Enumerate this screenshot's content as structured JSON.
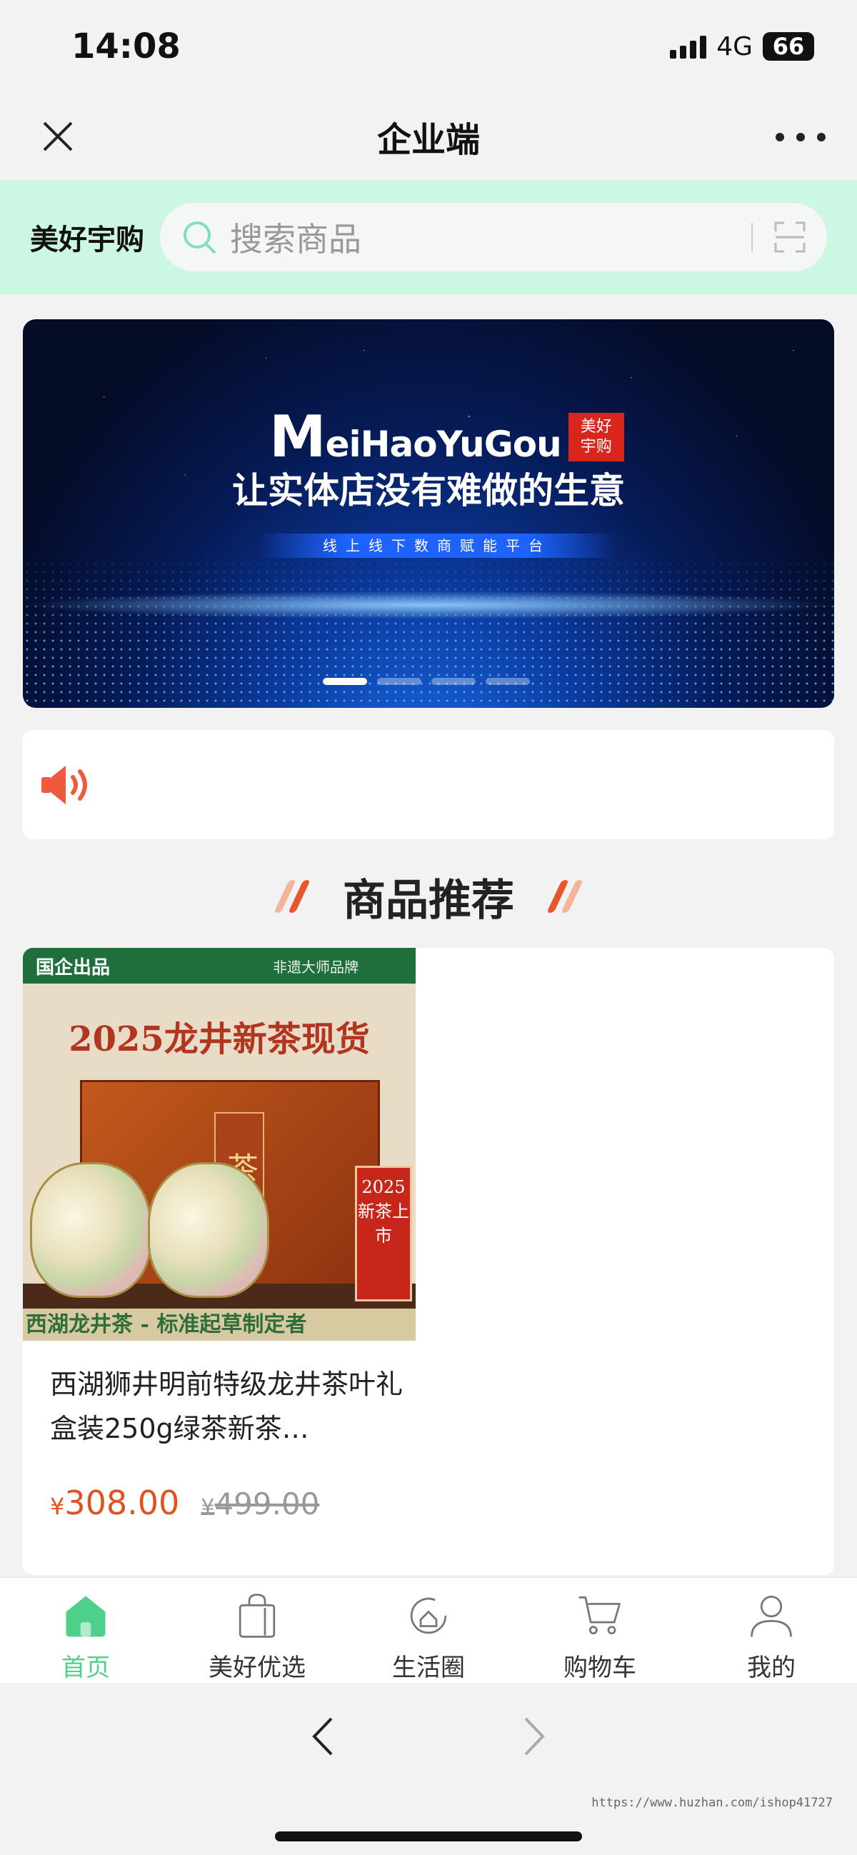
{
  "status_bar": {
    "time": "14:08",
    "network": "4G",
    "battery": "66"
  },
  "title_bar": {
    "title": "企业端"
  },
  "header": {
    "brand": "美好宇购",
    "search_placeholder": "搜索商品"
  },
  "banner": {
    "logo_text_big": "M",
    "logo_text_rest": "eiHaoYuGou",
    "logo_badge": "美好宇购",
    "headline": "让实体店没有难做的生意",
    "tagline": "线上线下数商赋能平台",
    "slide_count": 4,
    "active_slide": 1
  },
  "section": {
    "title": "商品推荐"
  },
  "products": [
    {
      "image": {
        "top_left": "国企出品",
        "top_right": "非遗大师品牌",
        "title": "2025龙井新茶现货",
        "box_label": "茶王",
        "stamp": "2025新茶上市",
        "bottom_banner": "西湖龙井茶 - 标准起草制定者"
      },
      "name": "西湖狮井明前特级龙井茶叶礼盒装250g绿茶新茶…",
      "currency": "¥",
      "price": "308.00",
      "original_price": "499.00"
    }
  ],
  "tabs": [
    {
      "label": "首页",
      "icon": "home-icon",
      "active": true
    },
    {
      "label": "美好优选",
      "icon": "shopping-bag-icon",
      "active": false
    },
    {
      "label": "生活圈",
      "icon": "life-circle-icon",
      "active": false
    },
    {
      "label": "购物车",
      "icon": "cart-icon",
      "active": false
    },
    {
      "label": "我的",
      "icon": "user-icon",
      "active": false
    }
  ],
  "watermark": "https://www.huzhan.com/ishop41727",
  "colors": {
    "accent": "#4fd08a",
    "header_bg": "#ccf7e3",
    "price": "#e2521f"
  }
}
